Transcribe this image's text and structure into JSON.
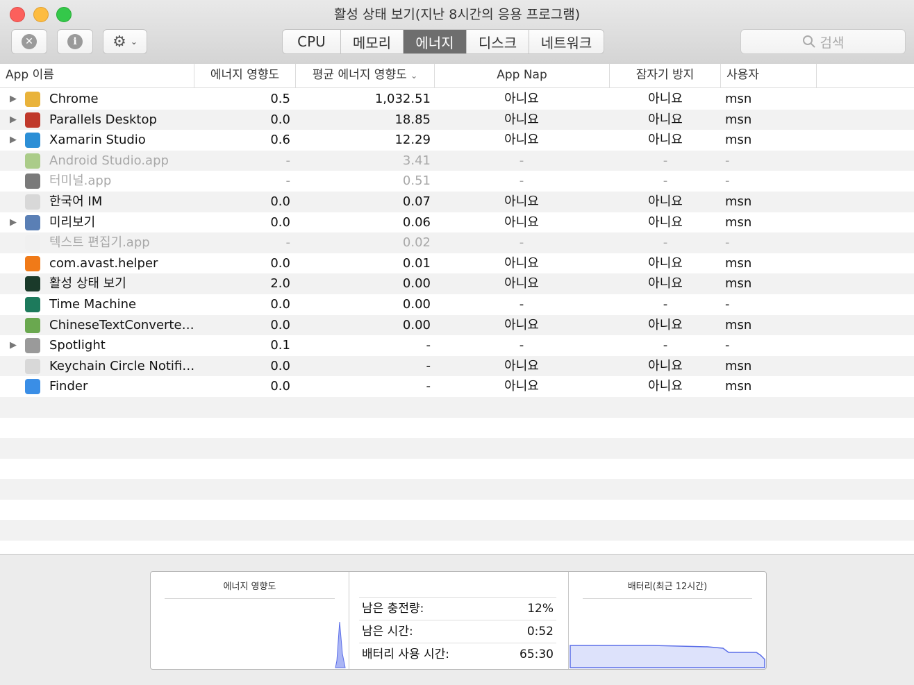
{
  "window": {
    "title": "활성 상태 보기(지난 8시간의 응용 프로그램)"
  },
  "toolbar": {
    "close_icon": "x-circle-icon",
    "info_icon": "info-icon",
    "gear_icon": "gear-icon",
    "tabs": [
      {
        "label": "CPU",
        "active": false
      },
      {
        "label": "메모리",
        "active": false
      },
      {
        "label": "에너지",
        "active": true
      },
      {
        "label": "디스크",
        "active": false
      },
      {
        "label": "네트워크",
        "active": false
      }
    ],
    "search_placeholder": "검색"
  },
  "table": {
    "columns": {
      "app_name": "App 이름",
      "energy_impact": "에너지 영향도",
      "avg_energy_impact": "평균 에너지 영향도",
      "app_nap": "App Nap",
      "prevent_sleep": "잠자기 방지",
      "user": "사용자"
    },
    "rows": [
      {
        "name": "Chrome",
        "impact": "0.5",
        "avg": "1,032.51",
        "nap": "아니요",
        "sleep": "아니요",
        "user": "msn",
        "expandable": true,
        "dim": false
      },
      {
        "name": "Parallels Desktop",
        "impact": "0.0",
        "avg": "18.85",
        "nap": "아니요",
        "sleep": "아니요",
        "user": "msn",
        "expandable": true,
        "dim": false
      },
      {
        "name": "Xamarin Studio",
        "impact": "0.6",
        "avg": "12.29",
        "nap": "아니요",
        "sleep": "아니요",
        "user": "msn",
        "expandable": true,
        "dim": false
      },
      {
        "name": "Android Studio.app",
        "impact": "-",
        "avg": "3.41",
        "nap": "-",
        "sleep": "-",
        "user": "-",
        "expandable": false,
        "dim": true
      },
      {
        "name": "터미널.app",
        "impact": "-",
        "avg": "0.51",
        "nap": "-",
        "sleep": "-",
        "user": "-",
        "expandable": false,
        "dim": true
      },
      {
        "name": "한국어 IM",
        "impact": "0.0",
        "avg": "0.07",
        "nap": "아니요",
        "sleep": "아니요",
        "user": "msn",
        "expandable": false,
        "dim": false
      },
      {
        "name": "미리보기",
        "impact": "0.0",
        "avg": "0.06",
        "nap": "아니요",
        "sleep": "아니요",
        "user": "msn",
        "expandable": true,
        "dim": false
      },
      {
        "name": "텍스트 편집기.app",
        "impact": "-",
        "avg": "0.02",
        "nap": "-",
        "sleep": "-",
        "user": "-",
        "expandable": false,
        "dim": true
      },
      {
        "name": "com.avast.helper",
        "impact": "0.0",
        "avg": "0.01",
        "nap": "아니요",
        "sleep": "아니요",
        "user": "msn",
        "expandable": false,
        "dim": false
      },
      {
        "name": "활성 상태 보기",
        "impact": "2.0",
        "avg": "0.00",
        "nap": "아니요",
        "sleep": "아니요",
        "user": "msn",
        "expandable": false,
        "dim": false
      },
      {
        "name": "Time Machine",
        "impact": "0.0",
        "avg": "0.00",
        "nap": "-",
        "sleep": "-",
        "user": "-",
        "expandable": false,
        "dim": false
      },
      {
        "name": "ChineseTextConverter...",
        "impact": "0.0",
        "avg": "0.00",
        "nap": "아니요",
        "sleep": "아니요",
        "user": "msn",
        "expandable": false,
        "dim": false
      },
      {
        "name": "Spotlight",
        "impact": "0.1",
        "avg": "-",
        "nap": "-",
        "sleep": "-",
        "user": "-",
        "expandable": true,
        "dim": false
      },
      {
        "name": "Keychain Circle Notific...",
        "impact": "0.0",
        "avg": "-",
        "nap": "아니요",
        "sleep": "아니요",
        "user": "msn",
        "expandable": false,
        "dim": false
      },
      {
        "name": "Finder",
        "impact": "0.0",
        "avg": "-",
        "nap": "아니요",
        "sleep": "아니요",
        "user": "msn",
        "expandable": false,
        "dim": false
      }
    ],
    "icon_colors": [
      "#e9b33b",
      "#c0392b",
      "#2c8fd6",
      "#7cb342",
      "#222222",
      "#d8d8d8",
      "#5a7fb5",
      "#eeeeee",
      "#f07a18",
      "#1a3a2a",
      "#1d7a5c",
      "#6aa84f",
      "#9a9a9a",
      "#d8d8d8",
      "#3a8ee6"
    ]
  },
  "bottom": {
    "energy_title": "에너지 영향도",
    "battery_title": "배터리(최근 12시간)",
    "stats": [
      {
        "label": "남은 충전량:",
        "value": "12%"
      },
      {
        "label": "남은 시간:",
        "value": "0:52"
      },
      {
        "label": "배터리 사용 시간:",
        "value": "65:30"
      }
    ],
    "chart_color": "#5b6ee8"
  }
}
